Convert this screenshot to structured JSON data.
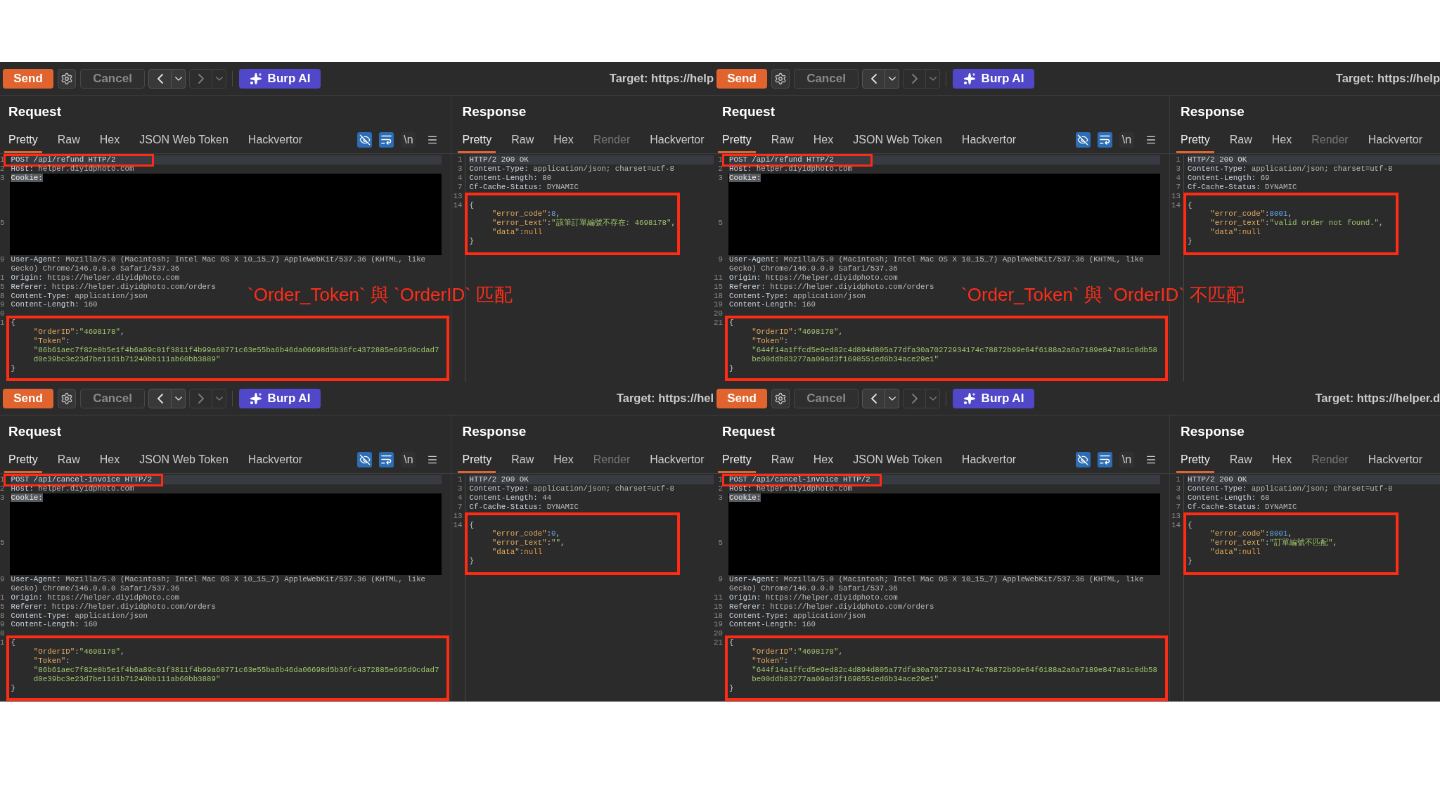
{
  "panels": [
    {
      "toolbar": {
        "send": "Send",
        "cancel": {
          "label": "Cancel",
          "disabled": true
        },
        "nav": [
          {
            "kind": "back",
            "disabled": false
          },
          {
            "kind": "forward",
            "disabled": true
          }
        ],
        "ai": "Burp AI",
        "target": "Target: https://help"
      },
      "request": {
        "title": "Request",
        "tabs": [
          {
            "label": "Pretty",
            "selected": true,
            "disabled": false
          },
          {
            "label": "Raw",
            "selected": false,
            "disabled": false
          },
          {
            "label": "Hex",
            "selected": false,
            "disabled": false
          },
          {
            "label": "JSON Web Token",
            "selected": false,
            "disabled": false
          },
          {
            "label": "Hackvertor",
            "selected": false,
            "disabled": false
          }
        ],
        "toggles": [
          {
            "kind": "hide",
            "on": true
          },
          {
            "kind": "wrap",
            "on": true
          },
          {
            "kind": "newline",
            "label": "\\n",
            "on": false
          }
        ],
        "first_line": {
          "no": "1",
          "text": "POST /api/refund HTTP/2",
          "boxed": true
        },
        "lines": [
          {
            "kind": "header",
            "no": "2",
            "name": "Host:",
            "value": "helper.diyidphoto.com",
            "selected": false
          },
          {
            "kind": "redacted",
            "numbers": [
              "3",
              "5"
            ],
            "name": "Cookie:",
            "selected": true
          },
          {
            "kind": "header",
            "no": "9",
            "name": "User-Agent:",
            "value": "Mozilla/5.0 (Macintosh; Intel Mac OS X 10_15_7) AppleWebKit/537.36 (KHTML, like Gecko) Chrome/146.0.0.0 Safari/537.36",
            "selected": false
          },
          {
            "kind": "header",
            "no": "1",
            "name": "Origin:",
            "value": "https://helper.diyidphoto.com",
            "selected": false
          },
          {
            "kind": "header",
            "no": "5",
            "name": "Referer:",
            "value": "https://helper.diyidphoto.com/orders",
            "selected": false
          },
          {
            "kind": "header",
            "no": "8",
            "name": "Content-Type:",
            "value": "application/json",
            "selected": false
          },
          {
            "kind": "header",
            "no": "9",
            "name": "Content-Length:",
            "value": "160",
            "selected": false
          },
          {
            "kind": "blank",
            "no": "0"
          }
        ],
        "body": {
          "no": "1",
          "boxed": true,
          "open": "{",
          "rows": [
            {
              "tokens": [
                {
                  "text": "\"OrderID\"",
                  "kind": "key"
                },
                {
                  "text": ":",
                  "kind": "punct"
                },
                {
                  "text": "\"4698178\"",
                  "kind": "string"
                },
                {
                  "text": ",",
                  "kind": "punct"
                }
              ]
            },
            {
              "tokens": [
                {
                  "text": "\"Token\"",
                  "kind": "key"
                },
                {
                  "text": ":",
                  "kind": "punct"
                }
              ]
            },
            {
              "tokens": [
                {
                  "text": "\"86b61aec7f82e0b5e1f4b6a89c01f3811f4b99a60771c63e55ba6b46da06698d5b36fc4372885e695d9cdad7d0e39bc3e23d7be11d1b71240bb111ab60bb3889\"",
                  "kind": "string"
                }
              ]
            }
          ],
          "close": "}"
        }
      },
      "response": {
        "title": "Response",
        "tabs": [
          {
            "label": "Pretty",
            "selected": true,
            "disabled": false
          },
          {
            "label": "Raw",
            "selected": false,
            "disabled": false
          },
          {
            "label": "Hex",
            "selected": false,
            "disabled": false
          },
          {
            "label": "Render",
            "selected": false,
            "disabled": true
          },
          {
            "label": "Hackvertor",
            "selected": false,
            "disabled": false
          }
        ],
        "first_line": {
          "no": "1",
          "text": "HTTP/2 200 OK"
        },
        "lines": [
          {
            "kind": "header",
            "no": "3",
            "name": "Content-Type:",
            "value": "application/json; charset=utf-8",
            "selected": false
          },
          {
            "kind": "header",
            "no": "4",
            "name": "Content-Length:",
            "value": "80",
            "selected": false
          },
          {
            "kind": "header",
            "no": "7",
            "name": "Cf-Cache-Status:",
            "value": "DYNAMIC",
            "selected": false
          },
          {
            "kind": "blank",
            "no": "13"
          }
        ],
        "body": {
          "no": "14",
          "boxed": true,
          "open": "{",
          "rows": [
            {
              "tokens": [
                {
                  "text": "\"error_code\"",
                  "kind": "key"
                },
                {
                  "text": ":",
                  "kind": "punct"
                },
                {
                  "text": "8",
                  "kind": "number"
                },
                {
                  "text": ",",
                  "kind": "punct"
                }
              ]
            },
            {
              "tokens": [
                {
                  "text": "\"error_text\"",
                  "kind": "key"
                },
                {
                  "text": ":",
                  "kind": "punct"
                },
                {
                  "text": "\"該筆訂單編號不存在: 4698178\"",
                  "kind": "string"
                },
                {
                  "text": ",",
                  "kind": "punct"
                }
              ]
            },
            {
              "tokens": [
                {
                  "text": "\"data\"",
                  "kind": "key"
                },
                {
                  "text": ":",
                  "kind": "punct"
                },
                {
                  "text": "null",
                  "kind": "null"
                }
              ]
            }
          ],
          "close": "}"
        }
      },
      "annotation": "`Order_Token` 與 `OrderID` 匹配"
    },
    {
      "toolbar": {
        "send": "Send",
        "cancel": {
          "label": "Cancel",
          "disabled": true
        },
        "nav": [
          {
            "kind": "back",
            "disabled": false
          },
          {
            "kind": "forward",
            "disabled": true
          }
        ],
        "ai": "Burp AI",
        "target": "Target: https://help"
      },
      "request": {
        "title": "Request",
        "tabs": [
          {
            "label": "Pretty",
            "selected": true,
            "disabled": false
          },
          {
            "label": "Raw",
            "selected": false,
            "disabled": false
          },
          {
            "label": "Hex",
            "selected": false,
            "disabled": false
          },
          {
            "label": "JSON Web Token",
            "selected": false,
            "disabled": false
          },
          {
            "label": "Hackvertor",
            "selected": false,
            "disabled": false
          }
        ],
        "toggles": [
          {
            "kind": "hide",
            "on": true
          },
          {
            "kind": "wrap",
            "on": true
          },
          {
            "kind": "newline",
            "label": "\\n",
            "on": false
          }
        ],
        "first_line": {
          "no": "1",
          "text": "POST /api/refund HTTP/2",
          "boxed": true
        },
        "lines": [
          {
            "kind": "header",
            "no": "2",
            "name": "Host:",
            "value": "helper.diyidphoto.com",
            "selected": false
          },
          {
            "kind": "redacted",
            "numbers": [
              "3",
              "5"
            ],
            "name": "Cookie:",
            "selected": true
          },
          {
            "kind": "header",
            "no": "9",
            "name": "User-Agent:",
            "value": "Mozilla/5.0 (Macintosh; Intel Mac OS X 10_15_7) AppleWebKit/537.36 (KHTML, like Gecko) Chrome/146.0.0.0 Safari/537.36",
            "selected": false
          },
          {
            "kind": "header",
            "no": "11",
            "name": "Origin:",
            "value": "https://helper.diyidphoto.com",
            "selected": false
          },
          {
            "kind": "header",
            "no": "15",
            "name": "Referer:",
            "value": "https://helper.diyidphoto.com/orders",
            "selected": false
          },
          {
            "kind": "header",
            "no": "18",
            "name": "Content-Type:",
            "value": "application/json",
            "selected": false
          },
          {
            "kind": "header",
            "no": "19",
            "name": "Content-Length:",
            "value": "160",
            "selected": false
          },
          {
            "kind": "blank",
            "no": "20"
          }
        ],
        "body": {
          "no": "21",
          "boxed": true,
          "open": "{",
          "rows": [
            {
              "tokens": [
                {
                  "text": "\"OrderID\"",
                  "kind": "key"
                },
                {
                  "text": ":",
                  "kind": "punct"
                },
                {
                  "text": "\"4698178\"",
                  "kind": "string"
                },
                {
                  "text": ",",
                  "kind": "punct"
                }
              ]
            },
            {
              "tokens": [
                {
                  "text": "\"Token\"",
                  "kind": "key"
                },
                {
                  "text": ":",
                  "kind": "punct"
                }
              ]
            },
            {
              "tokens": [
                {
                  "text": "\"644f14a1ffcd5e9ed82c4d894d805a77dfa30a70272934174c78872b99e64f6188a2a6a7189e847a81c0db58be00ddb83277aa09ad3f1698551ed6b34ace29e1\"",
                  "kind": "string"
                }
              ]
            }
          ],
          "close": "}"
        }
      },
      "response": {
        "title": "Response",
        "tabs": [
          {
            "label": "Pretty",
            "selected": true,
            "disabled": false
          },
          {
            "label": "Raw",
            "selected": false,
            "disabled": false
          },
          {
            "label": "Hex",
            "selected": false,
            "disabled": false
          },
          {
            "label": "Render",
            "selected": false,
            "disabled": true
          },
          {
            "label": "Hackvertor",
            "selected": false,
            "disabled": false
          }
        ],
        "first_line": {
          "no": "1",
          "text": "HTTP/2 200 OK"
        },
        "lines": [
          {
            "kind": "header",
            "no": "3",
            "name": "Content-Type:",
            "value": "application/json; charset=utf-8",
            "selected": false
          },
          {
            "kind": "header",
            "no": "4",
            "name": "Content-Length:",
            "value": "69",
            "selected": false
          },
          {
            "kind": "header",
            "no": "7",
            "name": "Cf-Cache-Status:",
            "value": "DYNAMIC",
            "selected": false
          },
          {
            "kind": "blank",
            "no": "13"
          }
        ],
        "body": {
          "no": "14",
          "boxed": true,
          "open": "{",
          "rows": [
            {
              "tokens": [
                {
                  "text": "\"error_code\"",
                  "kind": "key"
                },
                {
                  "text": ":",
                  "kind": "punct"
                },
                {
                  "text": "8001",
                  "kind": "number"
                },
                {
                  "text": ",",
                  "kind": "punct"
                }
              ]
            },
            {
              "tokens": [
                {
                  "text": "\"error_text\"",
                  "kind": "key"
                },
                {
                  "text": ":",
                  "kind": "punct"
                },
                {
                  "text": "\"valid order not found.\"",
                  "kind": "string"
                },
                {
                  "text": ",",
                  "kind": "punct"
                }
              ]
            },
            {
              "tokens": [
                {
                  "text": "\"data\"",
                  "kind": "key"
                },
                {
                  "text": ":",
                  "kind": "punct"
                },
                {
                  "text": "null",
                  "kind": "null"
                }
              ]
            }
          ],
          "close": "}"
        }
      },
      "annotation": "`Order_Token` 與 `OrderID` 不匹配"
    },
    {
      "toolbar": {
        "send": "Send",
        "cancel": {
          "label": "Cancel",
          "disabled": true
        },
        "nav": [
          {
            "kind": "back",
            "disabled": false
          },
          {
            "kind": "forward",
            "disabled": true
          }
        ],
        "ai": "Burp AI",
        "target": "Target: https://hel"
      },
      "request": {
        "title": "Request",
        "tabs": [
          {
            "label": "Pretty",
            "selected": true,
            "disabled": false
          },
          {
            "label": "Raw",
            "selected": false,
            "disabled": false
          },
          {
            "label": "Hex",
            "selected": false,
            "disabled": false
          },
          {
            "label": "JSON Web Token",
            "selected": false,
            "disabled": false
          },
          {
            "label": "Hackvertor",
            "selected": false,
            "disabled": false
          }
        ],
        "toggles": [
          {
            "kind": "hide",
            "on": true
          },
          {
            "kind": "wrap",
            "on": true
          },
          {
            "kind": "newline",
            "label": "\\n",
            "on": false
          }
        ],
        "first_line": {
          "no": "1",
          "text": "POST /api/cancel-invoice HTTP/2",
          "boxed": true
        },
        "lines": [
          {
            "kind": "header",
            "no": "2",
            "name": "Host:",
            "value": "helper.diyidphoto.com",
            "selected": false
          },
          {
            "kind": "redacted",
            "numbers": [
              "3",
              "5"
            ],
            "name": "Cookie:",
            "selected": true
          },
          {
            "kind": "header",
            "no": "9",
            "name": "User-Agent:",
            "value": "Mozilla/5.0 (Macintosh; Intel Mac OS X 10_15_7) AppleWebKit/537.36 (KHTML, like Gecko) Chrome/146.0.0.0 Safari/537.36",
            "selected": false
          },
          {
            "kind": "header",
            "no": "1",
            "name": "Origin:",
            "value": "https://helper.diyidphoto.com",
            "selected": false
          },
          {
            "kind": "header",
            "no": "5",
            "name": "Referer:",
            "value": "https://helper.diyidphoto.com/orders",
            "selected": false
          },
          {
            "kind": "header",
            "no": "8",
            "name": "Content-Type:",
            "value": "application/json",
            "selected": false
          },
          {
            "kind": "header",
            "no": "9",
            "name": "Content-Length:",
            "value": "160",
            "selected": false
          },
          {
            "kind": "blank",
            "no": "0"
          }
        ],
        "body": {
          "no": "1",
          "boxed": true,
          "open": "{",
          "rows": [
            {
              "tokens": [
                {
                  "text": "\"OrderID\"",
                  "kind": "key"
                },
                {
                  "text": ":",
                  "kind": "punct"
                },
                {
                  "text": "\"4698178\"",
                  "kind": "string"
                },
                {
                  "text": ",",
                  "kind": "punct"
                }
              ]
            },
            {
              "tokens": [
                {
                  "text": "\"Token\"",
                  "kind": "key"
                },
                {
                  "text": ":",
                  "kind": "punct"
                }
              ]
            },
            {
              "tokens": [
                {
                  "text": "\"86b61aec7f82e0b5e1f4b6a89c01f3811f4b99a60771c63e55ba6b46da06698d5b36fc4372885e695d9cdad7d0e39bc3e23d7be11d1b71240bb111ab60bb3889\"",
                  "kind": "string"
                }
              ]
            }
          ],
          "close": "}"
        }
      },
      "response": {
        "title": "Response",
        "tabs": [
          {
            "label": "Pretty",
            "selected": true,
            "disabled": false
          },
          {
            "label": "Raw",
            "selected": false,
            "disabled": false
          },
          {
            "label": "Hex",
            "selected": false,
            "disabled": false
          },
          {
            "label": "Render",
            "selected": false,
            "disabled": true
          },
          {
            "label": "Hackvertor",
            "selected": false,
            "disabled": false
          }
        ],
        "first_line": {
          "no": "1",
          "text": "HTTP/2 200 OK"
        },
        "lines": [
          {
            "kind": "header",
            "no": "3",
            "name": "Content-Type:",
            "value": "application/json; charset=utf-8",
            "selected": false
          },
          {
            "kind": "header",
            "no": "4",
            "name": "Content-Length:",
            "value": "44",
            "selected": false
          },
          {
            "kind": "header",
            "no": "7",
            "name": "Cf-Cache-Status:",
            "value": "DYNAMIC",
            "selected": false
          },
          {
            "kind": "blank",
            "no": "13"
          }
        ],
        "body": {
          "no": "14",
          "boxed": true,
          "open": "{",
          "rows": [
            {
              "tokens": [
                {
                  "text": "\"error_code\"",
                  "kind": "key"
                },
                {
                  "text": ":",
                  "kind": "punct"
                },
                {
                  "text": "0",
                  "kind": "number"
                },
                {
                  "text": ",",
                  "kind": "punct"
                }
              ]
            },
            {
              "tokens": [
                {
                  "text": "\"error_text\"",
                  "kind": "key"
                },
                {
                  "text": ":",
                  "kind": "punct"
                },
                {
                  "text": "\"\"",
                  "kind": "string"
                },
                {
                  "text": ",",
                  "kind": "punct"
                }
              ]
            },
            {
              "tokens": [
                {
                  "text": "\"data\"",
                  "kind": "key"
                },
                {
                  "text": ":",
                  "kind": "punct"
                },
                {
                  "text": "null",
                  "kind": "null"
                }
              ]
            }
          ],
          "close": "}"
        }
      }
    },
    {
      "toolbar": {
        "send": "Send",
        "cancel": {
          "label": "Cancel",
          "disabled": true
        },
        "nav": [
          {
            "kind": "back",
            "disabled": false
          },
          {
            "kind": "forward",
            "disabled": true
          }
        ],
        "ai": "Burp AI",
        "target": "Target: https://helper.d"
      },
      "request": {
        "title": "Request",
        "tabs": [
          {
            "label": "Pretty",
            "selected": true,
            "disabled": false
          },
          {
            "label": "Raw",
            "selected": false,
            "disabled": false
          },
          {
            "label": "Hex",
            "selected": false,
            "disabled": false
          },
          {
            "label": "JSON Web Token",
            "selected": false,
            "disabled": false
          },
          {
            "label": "Hackvertor",
            "selected": false,
            "disabled": false
          }
        ],
        "toggles": [
          {
            "kind": "hide",
            "on": true
          },
          {
            "kind": "wrap",
            "on": true
          },
          {
            "kind": "newline",
            "label": "\\n",
            "on": false
          }
        ],
        "first_line": {
          "no": "1",
          "text": "POST /api/cancel-invoice HTTP/2",
          "boxed": true
        },
        "lines": [
          {
            "kind": "header",
            "no": "2",
            "name": "Host:",
            "value": "helper.diyidphoto.com",
            "selected": false
          },
          {
            "kind": "redacted",
            "numbers": [
              "3",
              "5"
            ],
            "name": "Cookie:",
            "selected": true
          },
          {
            "kind": "header",
            "no": "9",
            "name": "User-Agent:",
            "value": "Mozilla/5.0 (Macintosh; Intel Mac OS X 10_15_7) AppleWebKit/537.36 (KHTML, like Gecko) Chrome/146.0.0.0 Safari/537.36",
            "selected": false
          },
          {
            "kind": "header",
            "no": "11",
            "name": "Origin:",
            "value": "https://helper.diyidphoto.com",
            "selected": false
          },
          {
            "kind": "header",
            "no": "15",
            "name": "Referer:",
            "value": "https://helper.diyidphoto.com/orders",
            "selected": false
          },
          {
            "kind": "header",
            "no": "18",
            "name": "Content-Type:",
            "value": "application/json",
            "selected": false
          },
          {
            "kind": "header",
            "no": "19",
            "name": "Content-Length:",
            "value": "160",
            "selected": false
          },
          {
            "kind": "blank",
            "no": "20"
          }
        ],
        "body": {
          "no": "21",
          "boxed": true,
          "open": "{",
          "rows": [
            {
              "tokens": [
                {
                  "text": "\"OrderID\"",
                  "kind": "key"
                },
                {
                  "text": ":",
                  "kind": "punct"
                },
                {
                  "text": "\"4698178\"",
                  "kind": "string"
                },
                {
                  "text": ",",
                  "kind": "punct"
                }
              ]
            },
            {
              "tokens": [
                {
                  "text": "\"Token\"",
                  "kind": "key"
                },
                {
                  "text": ":",
                  "kind": "punct"
                }
              ]
            },
            {
              "tokens": [
                {
                  "text": "\"644f14a1ffcd5e9ed82c4d894d805a77dfa30a70272934174c78872b99e64f6188a2a6a7189e847a81c0db58be00ddb83277aa09ad3f1698551ed6b34ace29e1\"",
                  "kind": "string"
                }
              ]
            }
          ],
          "close": "}"
        }
      },
      "response": {
        "title": "Response",
        "tabs": [
          {
            "label": "Pretty",
            "selected": true,
            "disabled": false
          },
          {
            "label": "Raw",
            "selected": false,
            "disabled": false
          },
          {
            "label": "Hex",
            "selected": false,
            "disabled": false
          },
          {
            "label": "Render",
            "selected": false,
            "disabled": true
          },
          {
            "label": "Hackvertor",
            "selected": false,
            "disabled": false
          }
        ],
        "first_line": {
          "no": "1",
          "text": "HTTP/2 200 OK"
        },
        "lines": [
          {
            "kind": "header",
            "no": "3",
            "name": "Content-Type:",
            "value": "application/json; charset=utf-8",
            "selected": false
          },
          {
            "kind": "header",
            "no": "4",
            "name": "Content-Length:",
            "value": "68",
            "selected": false
          },
          {
            "kind": "header",
            "no": "7",
            "name": "Cf-Cache-Status:",
            "value": "DYNAMIC",
            "selected": false
          },
          {
            "kind": "blank",
            "no": "13"
          }
        ],
        "body": {
          "no": "14",
          "boxed": true,
          "open": "{",
          "rows": [
            {
              "tokens": [
                {
                  "text": "\"error_code\"",
                  "kind": "key"
                },
                {
                  "text": ":",
                  "kind": "punct"
                },
                {
                  "text": "8001",
                  "kind": "number"
                },
                {
                  "text": ",",
                  "kind": "punct"
                }
              ]
            },
            {
              "tokens": [
                {
                  "text": "\"error_text\"",
                  "kind": "key"
                },
                {
                  "text": ":",
                  "kind": "punct"
                },
                {
                  "text": "\"訂單編號不匹配\"",
                  "kind": "string"
                },
                {
                  "text": ",",
                  "kind": "punct"
                }
              ]
            },
            {
              "tokens": [
                {
                  "text": "\"data\"",
                  "kind": "key"
                },
                {
                  "text": ":",
                  "kind": "punct"
                },
                {
                  "text": "null",
                  "kind": "null"
                }
              ]
            }
          ],
          "close": "}"
        }
      }
    }
  ]
}
